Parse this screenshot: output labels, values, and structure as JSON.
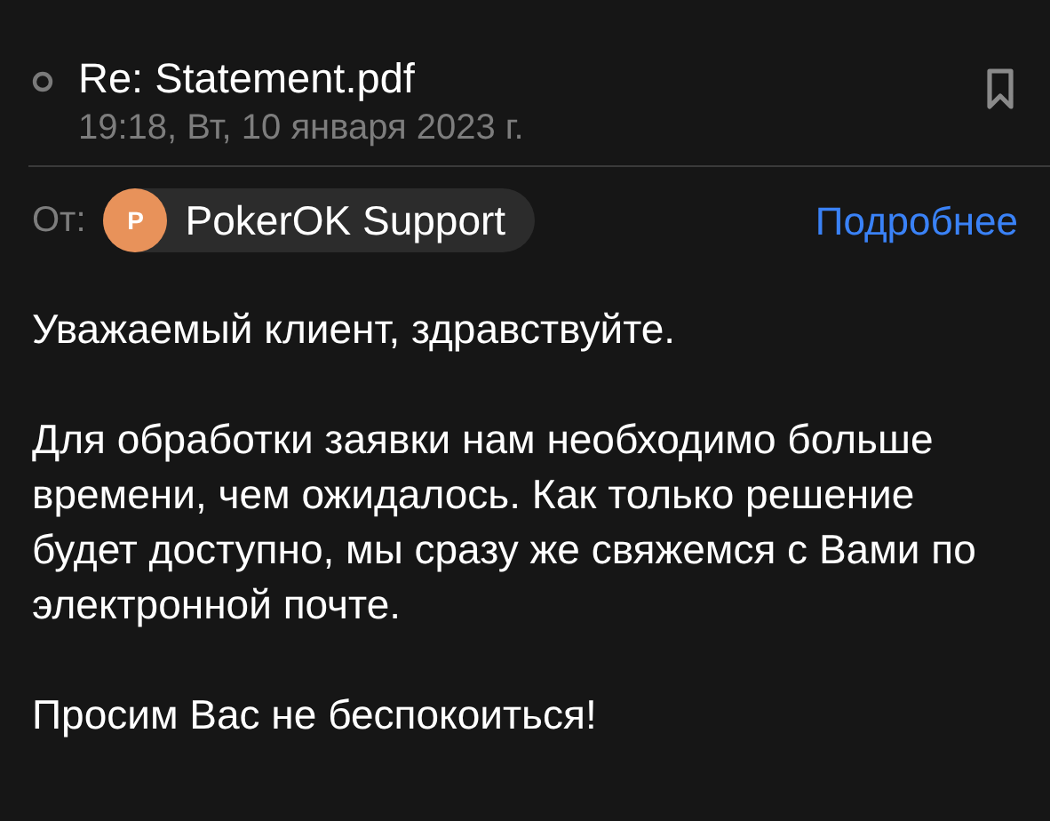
{
  "message": {
    "subject": "Re: Statement.pdf",
    "date": "19:18, Вт, 10 января 2023 г."
  },
  "sender": {
    "label": "От:",
    "avatar_letter": "P",
    "name": "PokerOK Support",
    "details_link": "Подробнее"
  },
  "body": [
    "Уважаемый клиент, здравствуйте.",
    "Для обработки заявки нам необходимо больше времени, чем ожидалось. Как только решение будет доступно, мы сразу же свяжемся с Вами по электронной почте.",
    "Просим Вас не беспокоиться!"
  ]
}
